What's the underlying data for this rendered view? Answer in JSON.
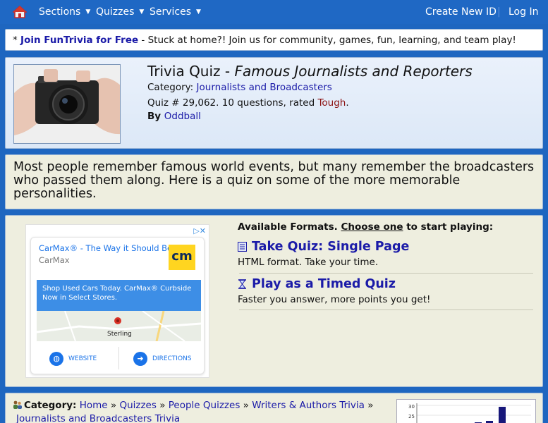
{
  "nav": {
    "items": [
      {
        "label": "Sections"
      },
      {
        "label": "Quizzes"
      },
      {
        "label": "Services"
      }
    ],
    "create_id": "Create New ID",
    "separator": "|",
    "login": "Log In"
  },
  "join": {
    "bullet": "* ",
    "link": "Join FunTrivia for Free",
    "text": " - Stuck at home?! Join us for community, games, fun, learning, and team play!"
  },
  "quiz": {
    "title_prefix": "Trivia Quiz - ",
    "title_name": "Famous Journalists and Reporters",
    "category_label": "Category: ",
    "category": "Journalists and Broadcasters",
    "number_text": "Quiz # 29,062. 10 questions, rated ",
    "rating": "Tough",
    "rating_end": ".",
    "by_label": "By ",
    "author": "Oddball"
  },
  "description": "Most people remember famous world events, but many remember the broadcasters who passed them along. Here is a quiz on some of the more memorable personalities.",
  "ad": {
    "title": "CarMax® - The Way it Should Be",
    "brand": "CarMax",
    "logo": "cm",
    "banner": "Shop Used Cars Today. CarMax® Curbside Now in Select Stores.",
    "map_label": "Sterling",
    "website": "WEBSITE",
    "directions": "DIRECTIONS"
  },
  "formats": {
    "heading_pre": "Available Formats. ",
    "heading_link": "Choose one",
    "heading_post": " to start playing:",
    "options": [
      {
        "label": "Take Quiz: Single Page",
        "desc": "HTML format. Take your time.",
        "icon": "page-icon"
      },
      {
        "label": "Play as a Timed Quiz",
        "desc": "Faster you answer, more points you get!",
        "icon": "hourglass-icon"
      }
    ]
  },
  "category_crumbs": {
    "label": "Category:",
    "items": [
      "Home",
      "Quizzes",
      "People Quizzes",
      "Writers & Authors Trivia",
      "Journalists and Broadcasters Trivia"
    ],
    "sep": "»"
  },
  "chart_thumb": {
    "ticks": [
      "30",
      "25"
    ]
  },
  "colors": {
    "nav_bg": "#1f68c4",
    "link": "#1b1ba8",
    "rating": "#8a0e0e",
    "panel_beige": "#eeeedf"
  }
}
